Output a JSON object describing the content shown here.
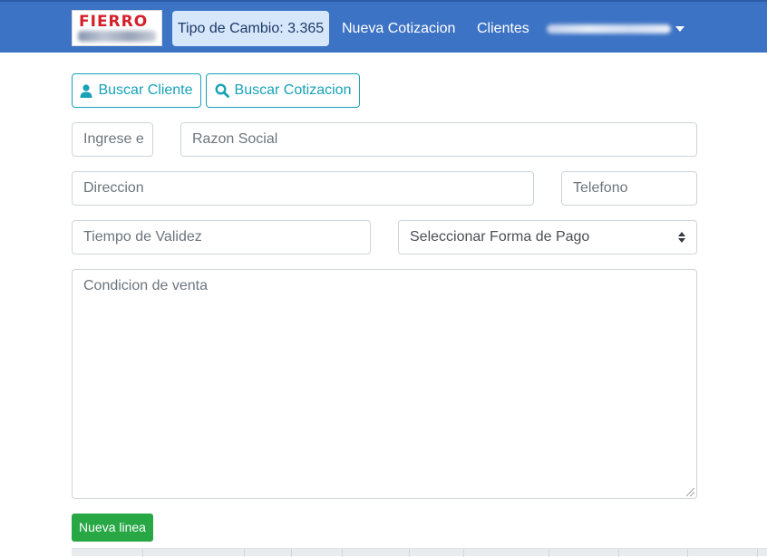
{
  "navbar": {
    "logo_text": "FIERRO",
    "exchange_rate": "Tipo de Cambio: 3.365",
    "links": [
      {
        "label": "Nueva Cotizacion"
      },
      {
        "label": "Clientes"
      }
    ],
    "user_menu_icon": "caret-down-icon"
  },
  "toolbar": {
    "buscar_cliente": {
      "label": "Buscar Cliente",
      "icon": "user-icon"
    },
    "buscar_cotizacion": {
      "label": "Buscar Cotizacion",
      "icon": "search-icon"
    }
  },
  "form": {
    "ruc_placeholder": "Ingrese e",
    "razon_social_placeholder": "Razon Social",
    "direccion_placeholder": "Direccion",
    "telefono_placeholder": "Telefono",
    "validez_placeholder": "Tiempo de Validez",
    "forma_pago_selected": "Seleccionar Forma de Pago",
    "condicion_placeholder": "Condicion de venta"
  },
  "actions": {
    "nueva_linea": "Nueva linea"
  },
  "colors": {
    "navbar": "#3d73c4",
    "info": "#17a2b8",
    "success": "#28a745",
    "logo_red": "#d4202a"
  }
}
